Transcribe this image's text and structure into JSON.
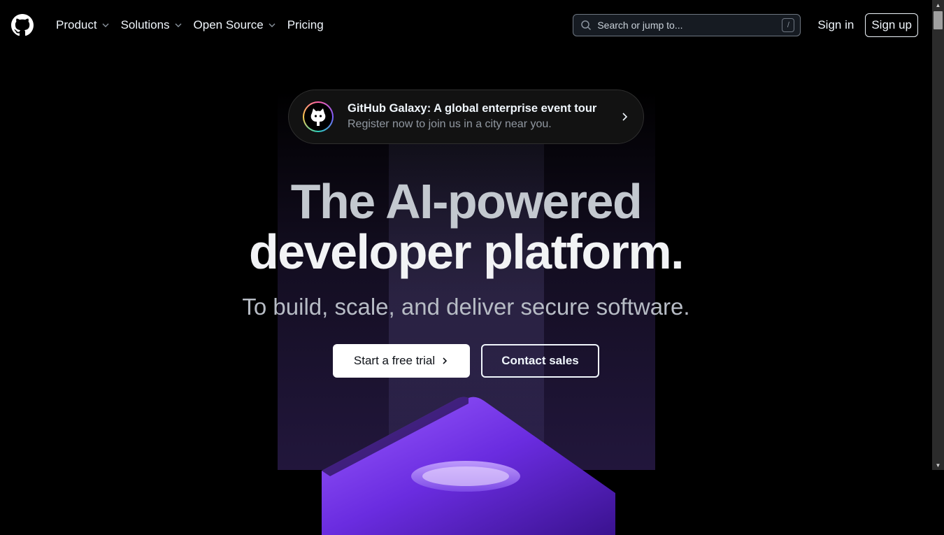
{
  "header": {
    "nav": [
      {
        "label": "Product",
        "has_dropdown": true
      },
      {
        "label": "Solutions",
        "has_dropdown": true
      },
      {
        "label": "Open Source",
        "has_dropdown": true
      },
      {
        "label": "Pricing",
        "has_dropdown": false
      }
    ],
    "search": {
      "placeholder": "Search or jump to...",
      "shortcut": "/"
    },
    "sign_in": "Sign in",
    "sign_up": "Sign up"
  },
  "banner": {
    "title": "GitHub Galaxy: A global enterprise event tour",
    "subtitle": "Register now to join us in a city near you."
  },
  "hero": {
    "title_line1": "The AI-powered",
    "title_line2": "developer platform.",
    "subtitle": "To build, scale, and deliver secure software."
  },
  "cta": {
    "primary": "Start a free trial",
    "secondary": "Contact sales"
  },
  "icons": {
    "logo": "github-logo-icon",
    "search": "search-icon",
    "dropdown": "chevron-down-icon",
    "banner_arrow": "chevron-right-icon"
  },
  "colors": {
    "background": "#000000",
    "banner_bg": "#121212",
    "accent_purple": "#7a3cff"
  }
}
